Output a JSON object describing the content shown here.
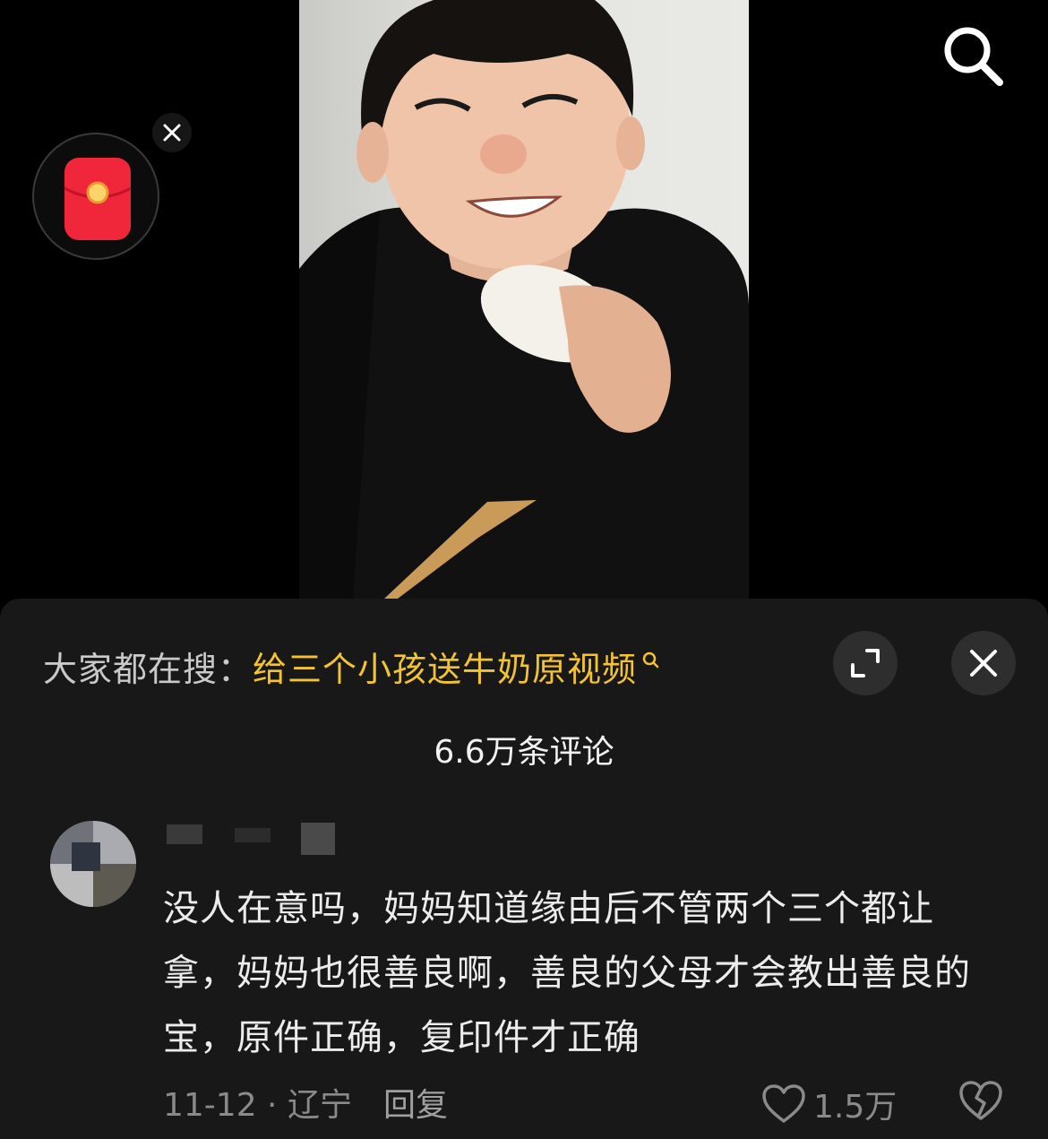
{
  "trending": {
    "label": "大家都在搜：",
    "query": "给三个小孩送牛奶原视频"
  },
  "comments": {
    "count_label": "6.6万条评论",
    "items": [
      {
        "text": "没人在意吗，妈妈知道缘由后不管两个三个都让拿，妈妈也很善良啊，善良的父母才会教出善良的宝，原件正确，复印件才正确",
        "date_location": "11-12 · 辽宁",
        "reply_label": "回复",
        "likes": "1.5万"
      }
    ]
  },
  "icons": {
    "search": "search-icon",
    "red_packet": "red-envelope-icon",
    "close": "close-icon",
    "expand": "expand-icon",
    "heart": "heart-icon",
    "dislike": "broken-heart-icon"
  },
  "colors": {
    "panel_bg": "#181818",
    "highlight": "#f4c430",
    "red_packet": "#f0273a"
  }
}
